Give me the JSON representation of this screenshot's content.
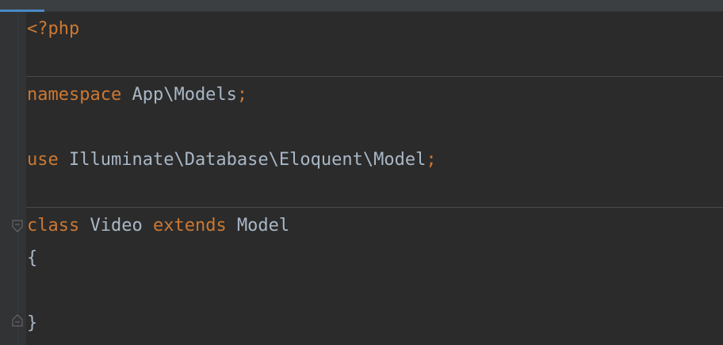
{
  "editor": {
    "language": "php",
    "colors": {
      "background": "#2b2b2b",
      "gutter": "#313335",
      "keyword": "#cc7832",
      "plain": "#a9b7c6",
      "tab_accent": "#4a88c7"
    },
    "lines": {
      "php_open": {
        "tag": "<?php"
      },
      "namespace": {
        "keyword": "namespace",
        "name": "App\\Models",
        "semicolon": ";"
      },
      "use": {
        "keyword": "use",
        "name": "Illuminate\\Database\\Eloquent\\Model",
        "semicolon": ";"
      },
      "class": {
        "keyword_class": "class",
        "name": "Video",
        "keyword_extends": "extends",
        "parent": "Model"
      },
      "brace_open": "{",
      "brace_close": "}"
    }
  }
}
